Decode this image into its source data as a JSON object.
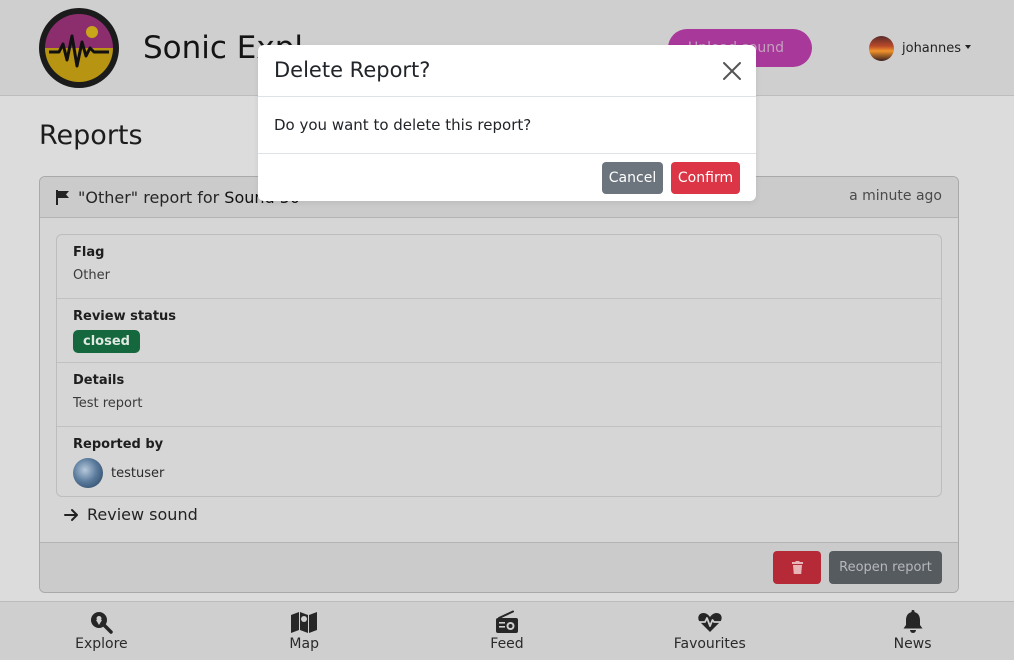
{
  "navbar": {
    "brand": "Sonic Expl",
    "upload_label": "Upload sound",
    "username": "johannes"
  },
  "page": {
    "title": "Reports"
  },
  "report": {
    "header_prefix": "\"Other\" report for ",
    "sound_name": "Sound 50",
    "time": "a minute ago",
    "flag_label": "Flag",
    "flag_value": "Other",
    "status_label": "Review status",
    "status_value": "closed",
    "details_label": "Details",
    "details_value": "Test report",
    "reported_by_label": "Reported by",
    "reporter": "testuser",
    "review_link": "Review sound",
    "reopen_label": "Reopen report"
  },
  "bottom_nav": {
    "items": [
      {
        "label": "Explore",
        "icon": "search-location-icon"
      },
      {
        "label": "Map",
        "icon": "map-icon"
      },
      {
        "label": "Feed",
        "icon": "radio-icon"
      },
      {
        "label": "Favourites",
        "icon": "heartbeat-icon"
      },
      {
        "label": "News",
        "icon": "bell-icon"
      }
    ]
  },
  "modal": {
    "title": "Delete Report?",
    "body": "Do you want to delete this report?",
    "cancel_label": "Cancel",
    "confirm_label": "Confirm"
  },
  "colors": {
    "confirm": "#dc3545",
    "cancel": "#6c757d",
    "status_closed": "#198754",
    "upload": "#c03fb0"
  }
}
